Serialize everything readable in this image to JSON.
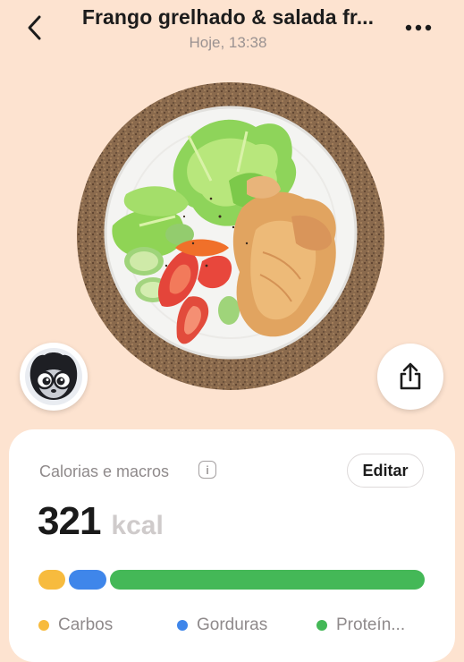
{
  "header": {
    "title": "Frango grelhado & salada fr...",
    "subtitle": "Hoje, 13:38"
  },
  "card": {
    "label": "Calorias e macros",
    "edit_label": "Editar",
    "kcal_value": "321",
    "kcal_unit": "kcal",
    "macros": [
      {
        "name": "Carbos",
        "color": "#f7bb3e"
      },
      {
        "name": "Gorduras",
        "color": "#3f86ea"
      },
      {
        "name": "Proteín...",
        "color": "#44b857"
      }
    ]
  },
  "icons": [
    "back-icon",
    "more-icon",
    "share-icon",
    "info-icon",
    "avatar-mascot"
  ]
}
